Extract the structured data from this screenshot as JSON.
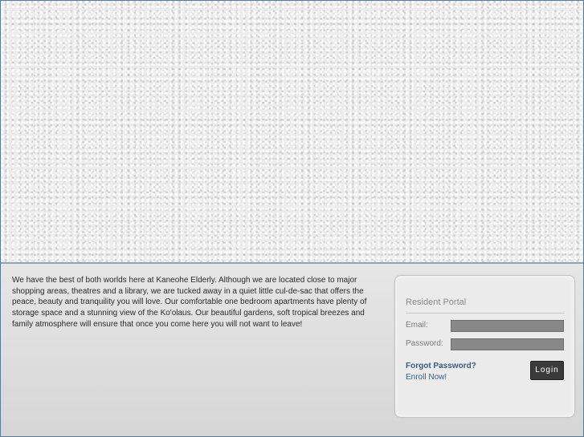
{
  "intro": {
    "text": "We have the best of both worlds here at Kaneohe Elderly. Although we are located close to major shopping areas, theatres and a library, we are tucked away in a quiet little cul-de-sac that offers the peace, beauty and tranquility you will love. Our comfortable one bedroom apartments have plenty of storage space and a stunning view of the Ko'olaus. Our beautiful gardens, soft tropical breezes and family atmosphere will ensure that once you come here you will not want to leave!"
  },
  "portal": {
    "title": "Resident Portal",
    "email_label": "Email:",
    "email_value": "",
    "password_label": "Password:",
    "password_value": "",
    "forgot_password": "Forgot Password?",
    "enroll_now": "Enroll Now!",
    "login_button": "Login"
  },
  "colors": {
    "page_border": "#5a7a99",
    "link": "#3a5e80",
    "input_fill": "#888888",
    "button_fill": "#3a3a3a"
  }
}
